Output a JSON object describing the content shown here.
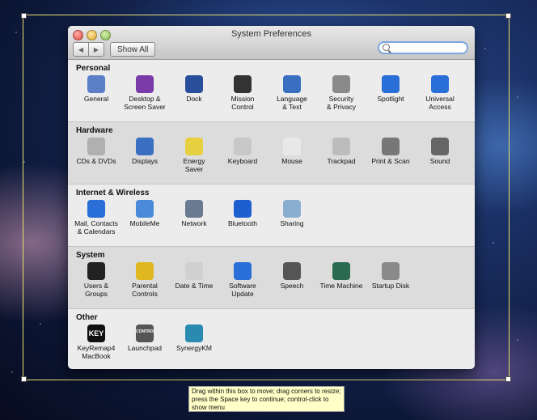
{
  "window": {
    "title": "System Preferences",
    "show_all_label": "Show All",
    "search_placeholder": ""
  },
  "sections": [
    {
      "title": "Personal",
      "items": [
        {
          "label": "General",
          "icon": "general-icon",
          "color": "#5b7fc6"
        },
        {
          "label": "Desktop &\nScreen Saver",
          "icon": "desktop-icon",
          "color": "#7a3aa8"
        },
        {
          "label": "Dock",
          "icon": "dock-icon",
          "color": "#2a4f9a"
        },
        {
          "label": "Mission\nControl",
          "icon": "mission-control-icon",
          "color": "#333333"
        },
        {
          "label": "Language\n& Text",
          "icon": "flag-icon",
          "color": "#3a6ec0"
        },
        {
          "label": "Security\n& Privacy",
          "icon": "house-lock-icon",
          "color": "#8a8a8a"
        },
        {
          "label": "Spotlight",
          "icon": "spotlight-icon",
          "color": "#2a6ed8"
        },
        {
          "label": "Universal\nAccess",
          "icon": "accessibility-icon",
          "color": "#2a6ed8"
        }
      ]
    },
    {
      "title": "Hardware",
      "items": [
        {
          "label": "CDs & DVDs",
          "icon": "cd-icon",
          "color": "#b0b0b0"
        },
        {
          "label": "Displays",
          "icon": "display-icon",
          "color": "#3a6ec0"
        },
        {
          "label": "Energy\nSaver",
          "icon": "lightbulb-icon",
          "color": "#e6d040"
        },
        {
          "label": "Keyboard",
          "icon": "keyboard-icon",
          "color": "#c8c8c8"
        },
        {
          "label": "Mouse",
          "icon": "mouse-icon",
          "color": "#e8e8e8"
        },
        {
          "label": "Trackpad",
          "icon": "trackpad-icon",
          "color": "#bcbcbc"
        },
        {
          "label": "Print & Scan",
          "icon": "printer-icon",
          "color": "#777777"
        },
        {
          "label": "Sound",
          "icon": "speaker-icon",
          "color": "#666666"
        }
      ]
    },
    {
      "title": "Internet & Wireless",
      "items": [
        {
          "label": "Mail, Contacts\n& Calendars",
          "icon": "at-icon",
          "color": "#2a6ed8"
        },
        {
          "label": "MobileMe",
          "icon": "cloud-icon",
          "color": "#4a8ad8"
        },
        {
          "label": "Network",
          "icon": "globe-icon",
          "color": "#6a7a90"
        },
        {
          "label": "Bluetooth",
          "icon": "bluetooth-icon",
          "color": "#1e5fd0"
        },
        {
          "label": "Sharing",
          "icon": "folder-icon",
          "color": "#8aaed0"
        }
      ]
    },
    {
      "title": "System",
      "items": [
        {
          "label": "Users &\nGroups",
          "icon": "users-icon",
          "color": "#222222"
        },
        {
          "label": "Parental\nControls",
          "icon": "parental-icon",
          "color": "#e0b820"
        },
        {
          "label": "Date & Time",
          "icon": "clock-icon",
          "color": "#d0d0d0"
        },
        {
          "label": "Software\nUpdate",
          "icon": "update-icon",
          "color": "#2a6ed8"
        },
        {
          "label": "Speech",
          "icon": "microphone-icon",
          "color": "#555555"
        },
        {
          "label": "Time Machine",
          "icon": "time-machine-icon",
          "color": "#2a6a50"
        },
        {
          "label": "Startup Disk",
          "icon": "disk-icon",
          "color": "#8a8a8a"
        }
      ]
    },
    {
      "title": "Other",
      "items": [
        {
          "label": "KeyRemap4\nMacBook",
          "icon": "key-icon",
          "color": "#111111",
          "text": "KEY"
        },
        {
          "label": "Launchpad",
          "icon": "control-icon",
          "color": "#555555",
          "text": "CONTROL"
        },
        {
          "label": "SynergyKM",
          "icon": "synergy-icon",
          "color": "#2a8ab0"
        }
      ]
    }
  ],
  "tooltip": "Drag within this box to move; drag corners to resize; press the Space key to continue; control-click to show menu"
}
